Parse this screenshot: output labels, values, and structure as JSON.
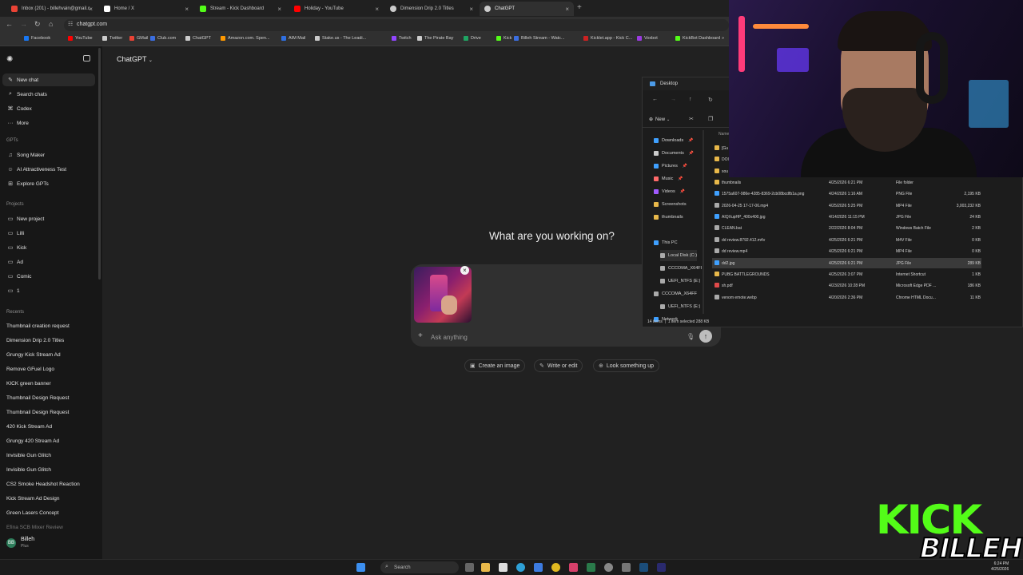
{
  "browser": {
    "tabs": [
      {
        "title": "Inbox (201) - billehvain@gmail.c",
        "color": "#ea4335"
      },
      {
        "title": "Home / X",
        "color": "#ffffff"
      },
      {
        "title": "Stream - Kick Dashboard",
        "color": "#53fc18"
      },
      {
        "title": "Holiday - YouTube",
        "color": "#ff0000"
      },
      {
        "title": "Dimension Drip 2.0 Titles",
        "color": "#cccccc"
      },
      {
        "title": "ChatGPT",
        "color": "#cccccc"
      }
    ],
    "url": "chatgpt.com",
    "bookmarks": [
      {
        "label": "Facebook",
        "color": "#1877f2"
      },
      {
        "label": "YouTube",
        "color": "#ff0000"
      },
      {
        "label": "Twitter",
        "color": "#cccccc"
      },
      {
        "label": "GMail",
        "color": "#ea4335"
      },
      {
        "label": "Club.com",
        "color": "#3b6ee0"
      },
      {
        "label": "ChatGPT",
        "color": "#cccccc"
      },
      {
        "label": "Amazon.com. Spen...",
        "color": "#ff9900"
      },
      {
        "label": "AIM Mail",
        "color": "#2f6fe0"
      },
      {
        "label": "Stake.us - The Leadi...",
        "color": "#cccccc"
      },
      {
        "label": "Twitch",
        "color": "#9146ff"
      },
      {
        "label": "The Pirate Bay",
        "color": "#cccccc"
      },
      {
        "label": "Drive",
        "color": "#1fa463"
      },
      {
        "label": "Kick",
        "color": "#53fc18"
      },
      {
        "label": "Billeh Stream - Watc...",
        "color": "#3b6ee0"
      },
      {
        "label": "Kicklet.app - Kick C...",
        "color": "#cc2222"
      },
      {
        "label": "Voxbot",
        "color": "#9b3be0"
      },
      {
        "label": "KickBot Dashboard",
        "color": "#53fc18"
      }
    ]
  },
  "sidebar": {
    "top": [
      {
        "label": "New chat",
        "icon": "edit-icon"
      },
      {
        "label": "Search chats",
        "icon": "search-icon"
      },
      {
        "label": "Codex",
        "icon": "codex-icon"
      },
      {
        "label": "More",
        "icon": "more-icon"
      }
    ],
    "gpts_heading": "GPTs",
    "gpts": [
      {
        "label": "Song Maker"
      },
      {
        "label": "AI Attractiveness Test"
      },
      {
        "label": "Explore GPTs"
      }
    ],
    "projects_heading": "Projects",
    "projects": [
      {
        "label": "New project"
      },
      {
        "label": "Lilli"
      },
      {
        "label": "Kick"
      },
      {
        "label": "Ad"
      },
      {
        "label": "Comic"
      },
      {
        "label": "1"
      }
    ],
    "recents_heading": "Recents",
    "recents": [
      "Thumbnail creation request",
      "Dimension Drip 2.0 Titles",
      "Grungy Kick Stream Ad",
      "Remove GFuel Logo",
      "KICK green banner",
      "Thumbnail Design Request",
      "Thumbnail Design Request",
      "420 Kick Stream Ad",
      "Grungy 420 Stream Ad",
      "Invisible Gun Glitch",
      "Invisible Gun Glitch",
      "CS2 Smoke Headshot Reaction",
      "Kick Stream Ad Design",
      "Green Lasers Concept",
      "Efina SCB Mixer Review"
    ],
    "user": {
      "name": "Billeh",
      "plan": "Plus",
      "initials": "BB"
    }
  },
  "main": {
    "model": "ChatGPT",
    "heading": "What are you working on?",
    "placeholder": "Ask anything",
    "chips": [
      {
        "label": "Create an image",
        "icon": "image-icon"
      },
      {
        "label": "Write or edit",
        "icon": "pen-icon"
      },
      {
        "label": "Look something up",
        "icon": "globe-icon"
      }
    ]
  },
  "explorer": {
    "title": "Desktop",
    "new_label": "New",
    "nav": [
      {
        "label": "Downloads",
        "color": "#3fa0ff",
        "pinned": true
      },
      {
        "label": "Documents",
        "color": "#cccccc",
        "pinned": true
      },
      {
        "label": "Pictures",
        "color": "#3fa0ff",
        "pinned": true
      },
      {
        "label": "Music",
        "color": "#ff6a6a",
        "pinned": true
      },
      {
        "label": "Videos",
        "color": "#a05aff",
        "pinned": true
      },
      {
        "label": "Screenshots",
        "color": "#e8b84a",
        "pinned": false
      },
      {
        "label": "thumbnails",
        "color": "#e8b84a",
        "pinned": false
      },
      {
        "label": "This PC",
        "color": "#3fa0ff",
        "pinned": false
      },
      {
        "label": "Local Disk (C:)",
        "color": "#aaaaaa",
        "pinned": false
      },
      {
        "label": "CCCOMA_X64FI",
        "color": "#aaaaaa",
        "pinned": false
      },
      {
        "label": "UEFI_NTFS (E:)",
        "color": "#aaaaaa",
        "pinned": false
      },
      {
        "label": "CCCOMA_X64FF",
        "color": "#aaaaaa",
        "pinned": false
      },
      {
        "label": "UEFI_NTFS (E:)",
        "color": "#aaaaaa",
        "pinned": false
      },
      {
        "label": "Network",
        "color": "#3fa0ff",
        "pinned": false
      }
    ],
    "name_header": "Name",
    "files": [
      {
        "name": "[Gu",
        "date": "",
        "type": "",
        "size": "",
        "color": "#e8b84a"
      },
      {
        "name": "DOI",
        "date": "",
        "type": "",
        "size": "",
        "color": "#e8b84a"
      },
      {
        "name": "sou",
        "date": "",
        "type": "",
        "size": "",
        "color": "#e8b84a"
      },
      {
        "name": "thumbnails",
        "date": "4/25/2026 6:21 PM",
        "type": "File folder",
        "size": "",
        "color": "#e8b84a"
      },
      {
        "name": "1575a607-986e-4285-8369-2cb08bcdfb1a.png",
        "date": "4/24/2026 1:16 AM",
        "type": "PNG File",
        "size": "2,195 KB",
        "color": "#3fa0ff"
      },
      {
        "name": "2026-04-25 17-17-06.mp4",
        "date": "4/25/2026 5:25 PM",
        "type": "MP4 File",
        "size": "3,003,232 KB",
        "color": "#aaaaaa"
      },
      {
        "name": "AIQXupHP_400x400.jpg",
        "date": "4/14/2026 11:15 PM",
        "type": "JPG File",
        "size": "24 KB",
        "color": "#3fa0ff"
      },
      {
        "name": "CLEAN.bat",
        "date": "2/22/2026 8:04 PM",
        "type": "Windows Batch File",
        "size": "2 KB",
        "color": "#aaaaaa"
      },
      {
        "name": "dd review.8792.412.m4v",
        "date": "4/25/2026 6:21 PM",
        "type": "M4V File",
        "size": "0 KB",
        "color": "#aaaaaa"
      },
      {
        "name": "dd review.mp4",
        "date": "4/25/2026 6:21 PM",
        "type": "MP4 File",
        "size": "0 KB",
        "color": "#aaaaaa"
      },
      {
        "name": "dd2.jpg",
        "date": "4/25/2026 6:21 PM",
        "type": "JPG File",
        "size": "289 KB",
        "color": "#3fa0ff",
        "selected": true
      },
      {
        "name": "PUBG BATTLEGROUNDS",
        "date": "4/25/2026 3:07 PM",
        "type": "Internet Shortcut",
        "size": "1 KB",
        "color": "#e8b84a"
      },
      {
        "name": "sh.pdf",
        "date": "4/23/2026 10:28 PM",
        "type": "Microsoft Edge PDF ...",
        "size": "186 KB",
        "color": "#e04a4a"
      },
      {
        "name": "venom emote.webp",
        "date": "4/20/2026 2:36 PM",
        "type": "Chrome HTML Docu...",
        "size": "11 KB",
        "color": "#aaaaaa"
      }
    ],
    "status_items": "14 items",
    "status_selected": "1 item selected  288 KB"
  },
  "overlay": {
    "logo_top": "KICK",
    "logo_bottom": "BILLEH"
  },
  "taskbar": {
    "search_label": "Search",
    "time": "6:24 PM",
    "date": "4/25/2026"
  }
}
